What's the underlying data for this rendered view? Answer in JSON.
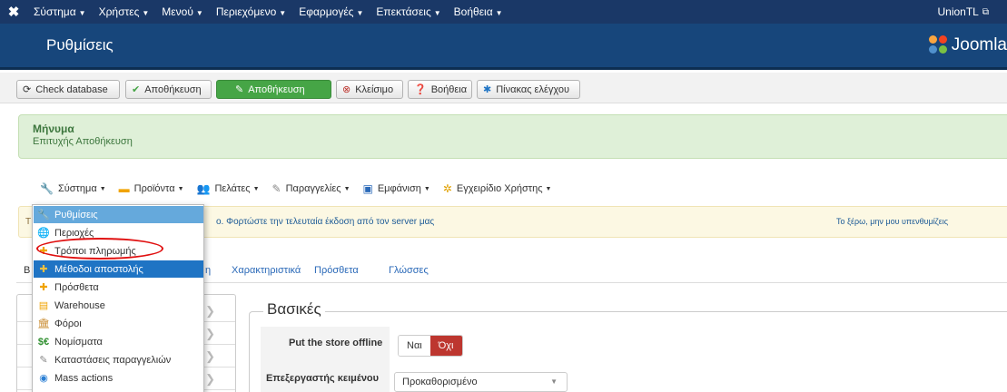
{
  "topnav": {
    "logo": "✖",
    "items": [
      "Σύστημα",
      "Χρήστες",
      "Μενού",
      "Περιεχόμενο",
      "Εφαρμογές",
      "Επεκτάσεις",
      "Βοήθεια"
    ],
    "right_label": "UnionTL",
    "right_icon": "external-link-icon"
  },
  "header": {
    "title": "Ρυθμίσεις",
    "brand": "Joomla"
  },
  "toolbar": {
    "check_db": "Check database",
    "save": "Αποθήκευση",
    "save_close": "Αποθήκευση",
    "close": "Κλείσιμο",
    "help": "Βοήθεια",
    "dashboard": "Πίνακας ελέγχου"
  },
  "message": {
    "heading": "Μήνυμα",
    "body": "Επιτυχής Αποθήκευση"
  },
  "hikamenu": {
    "items": [
      "Σύστημα",
      "Προϊόντα",
      "Πελάτες",
      "Παραγγελίες",
      "Εμφάνιση",
      "Εγχειρίδιο Χρήστης"
    ]
  },
  "update_notice": {
    "prefix": "T",
    "text": "ο. Φορτώστε την τελευταία έκδοση από τον server μας",
    "dismiss": "Το ξέρω, μην μου υπενθυμίζεις"
  },
  "tabs": {
    "partial_left": "B",
    "partial_right": "η",
    "items": [
      "Χαρακτηριστικά",
      "Πρόσθετα",
      "Γλώσσες"
    ]
  },
  "dropdown": {
    "items": [
      "Ρυθμίσεις",
      "Περιοχές",
      "Τρόποι πληρωμής",
      "Μέθοδοι αποστολής",
      "Πρόσθετα",
      "Warehouse",
      "Φόροι",
      "Νομίσματα",
      "Καταστάσεις παραγγελιών",
      "Mass actions"
    ],
    "icons": [
      "wrench-icon",
      "globe-icon",
      "plugin-icon",
      "plugin-icon",
      "plugin-icon",
      "warehouse-icon",
      "tax-icon",
      "currency-icon",
      "order-status-icon",
      "mass-actions-icon"
    ],
    "highlighted": "Ρυθμίσεις",
    "selected": "Μέθοδοι αποστολής",
    "circled": "Τρόποι πληρωμής"
  },
  "settings": {
    "legend": "Βασικές",
    "offline_label": "Put the store offline",
    "offline_yes": "Ναι",
    "offline_no": "Όχι",
    "offline_value": "Όχι",
    "editor_label": "Επεξεργαστής κειμένου",
    "editor_value": "Προκαθορισμένο"
  },
  "colors": {
    "topbar": "#1a3867",
    "titlebar": "#17467b",
    "save_green": "#46a546",
    "active_no": "#bd362f",
    "menu_selected": "#1f74c4",
    "circle": "#e01010"
  }
}
